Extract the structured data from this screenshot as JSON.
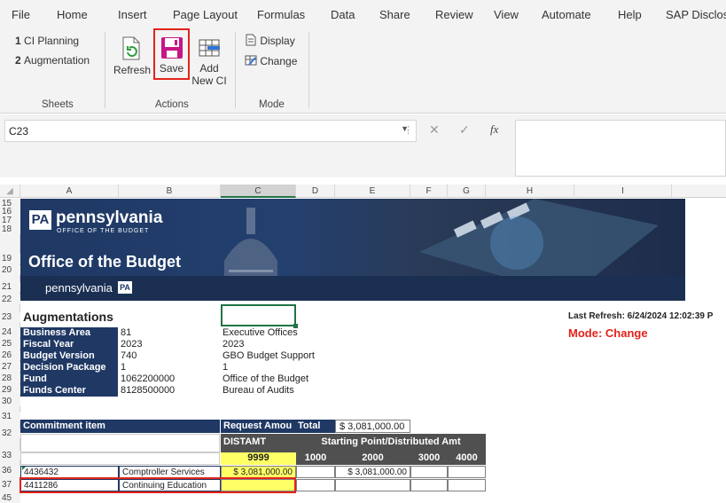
{
  "menu": [
    "File",
    "Home",
    "Insert",
    "Page Layout",
    "Formulas",
    "Data",
    "Share",
    "Review",
    "View",
    "Automate",
    "Help",
    "SAP Disclos"
  ],
  "ribbon": {
    "sheets": [
      {
        "num": "1",
        "label": "CI Planning"
      },
      {
        "num": "2",
        "label": "Augmentation"
      }
    ],
    "sheets_group": "Sheets",
    "actions": {
      "refresh": "Refresh",
      "save": "Save",
      "add_line1": "Add",
      "add_line2": "New CI"
    },
    "actions_group": "Actions",
    "mode": {
      "display": "Display",
      "change": "Change"
    },
    "mode_group": "Mode"
  },
  "formula_bar": {
    "name_box": "C23",
    "fx": "fx",
    "cancel": "✕",
    "enter": "✓"
  },
  "columns": [
    "A",
    "B",
    "C",
    "D",
    "E",
    "F",
    "G",
    "H",
    "I"
  ],
  "rows": {
    "r15": "15",
    "r16": "16",
    "r17": "17",
    "r18": "18",
    "r19": "19",
    "r20": "20",
    "r21": "21",
    "r22": "22",
    "r23": "23",
    "r24": "24",
    "r25": "25",
    "r26": "26",
    "r27": "27",
    "r28": "28",
    "r29": "29",
    "r30": "30",
    "r31": "31",
    "r32": "32",
    "r33": "33",
    "r36": "36",
    "r37": "37",
    "r45": "45"
  },
  "banner": {
    "logo_pa": "PA",
    "logo_name": "pennsylvania",
    "logo_sub": "OFFICE OF THE BUDGET",
    "title": "Office of the Budget",
    "footer": "pennsylvania",
    "footer_badge": "PA"
  },
  "sheet": {
    "heading": "Augmentations",
    "last_refresh": "Last Refresh: 6/24/2024 12:02:39 P",
    "mode": "Mode: Change",
    "info": [
      {
        "label": "Business Area",
        "code": "81",
        "desc": "Executive Offices"
      },
      {
        "label": "Fiscal Year",
        "code": "2023",
        "desc": "2023"
      },
      {
        "label": "Budget Version",
        "code": "740",
        "desc": "GBO Budget Support"
      },
      {
        "label": "Decision Package",
        "code": "1",
        "desc": "1"
      },
      {
        "label": "Fund",
        "code": "1062200000",
        "desc": "Office of the Budget"
      },
      {
        "label": "Funds Center",
        "code": "8128500000",
        "desc": "Bureau of Audits"
      }
    ],
    "table": {
      "commitment_header": "Commitment item",
      "request_amt": "Request Amou",
      "total_label": "Total",
      "total_value": "$ 3,081,000.00",
      "distamt": "DISTAMT",
      "starting_point": "Starting Point/Distributed Amt",
      "col_9999": "9999",
      "col_1000": "1000",
      "col_2000": "2000",
      "col_3000": "3000",
      "col_4000": "4000",
      "rows": [
        {
          "code": "4436432",
          "name": "Comptroller Services",
          "amount": "$ 3,081,000.00",
          "e": "$ 3,081,000.00"
        },
        {
          "code": "4411286",
          "name": "Continuing Education",
          "amount": "",
          "e": ""
        }
      ]
    }
  },
  "colors": {
    "accent": "#1f3864",
    "highlight": "#ffff66",
    "alert": "#e2231a",
    "selection": "#217346"
  }
}
